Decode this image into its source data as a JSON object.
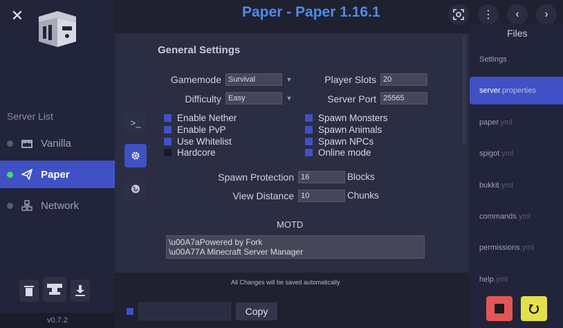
{
  "app": {
    "title": "Paper - Paper 1.16.1",
    "version": "v0.7.2"
  },
  "sidebar": {
    "server_list_label": "Server List",
    "servers": [
      {
        "label": "Vanilla",
        "icon": "chest-icon",
        "active": false
      },
      {
        "label": "Paper",
        "icon": "paper-plane-icon",
        "active": true
      },
      {
        "label": "Network",
        "icon": "network-icon",
        "active": false
      }
    ],
    "tools": [
      "trash-icon",
      "anvil-icon",
      "download-icon"
    ]
  },
  "settings": {
    "heading": "General Settings",
    "gamemode_label": "Gamemode",
    "gamemode_value": "Survival",
    "difficulty_label": "Difficulty",
    "difficulty_value": "Easy",
    "player_slots_label": "Player Slots",
    "player_slots_value": "20",
    "server_port_label": "Server Port",
    "server_port_value": "25565",
    "checkboxes_left": [
      {
        "label": "Enable Nether",
        "checked": true
      },
      {
        "label": "Enable PvP",
        "checked": true
      },
      {
        "label": "Use Whitelist",
        "checked": true
      },
      {
        "label": "Hardcore",
        "checked": false
      }
    ],
    "checkboxes_right": [
      {
        "label": "Spawn Monsters",
        "checked": true
      },
      {
        "label": "Spawn Animals",
        "checked": true
      },
      {
        "label": "Spawn NPCs",
        "checked": true
      },
      {
        "label": "Online mode",
        "checked": true
      }
    ],
    "spawn_protection_label": "Spawn Protection",
    "spawn_protection_value": "16",
    "spawn_protection_unit": "Blocks",
    "view_distance_label": "View Distance",
    "view_distance_value": "10",
    "view_distance_unit": "Chunks",
    "motd_label": "MOTD",
    "motd_line1": "\\u00A7aPowered by Fork",
    "motd_line2": "\\u00A77A Minecraft Server Manager",
    "autosave_note": "All Changes will be saved automatically"
  },
  "console": {
    "copy_label": "Copy"
  },
  "files": {
    "heading": "Files",
    "items": [
      {
        "name": "Settings",
        "ext": "",
        "active": false
      },
      {
        "name": "server",
        "ext": ".properties",
        "active": true
      },
      {
        "name": "paper",
        "ext": ".yml",
        "active": false
      },
      {
        "name": "spigot",
        "ext": ".yml",
        "active": false
      },
      {
        "name": "bukkit",
        "ext": ".yml",
        "active": false
      },
      {
        "name": "commands",
        "ext": ".yml",
        "active": false
      },
      {
        "name": "permissions",
        "ext": ".yml",
        "active": false
      },
      {
        "name": "help",
        "ext": ".yml",
        "active": false
      }
    ]
  },
  "colors": {
    "accent": "#3f51c4",
    "title": "#4f8ce6",
    "stop": "#e35656",
    "restart": "#e4e04a",
    "online": "#45d96a"
  }
}
